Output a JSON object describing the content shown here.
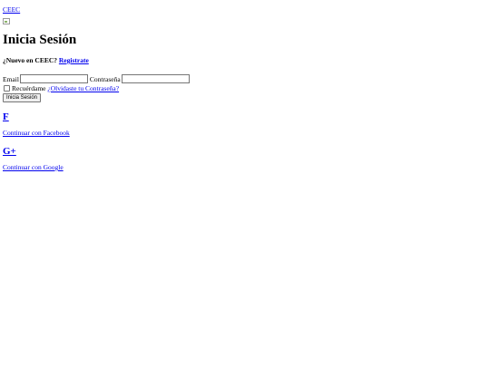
{
  "header": {
    "brand_link": "CEEC"
  },
  "login": {
    "title": "Inicia Sesión",
    "new_prompt": "¿Nuevo en CEEC?",
    "register_link": "Registrate",
    "email_label": "Email",
    "email_value": "",
    "password_label": "Contraseña",
    "password_value": "",
    "remember_label": "Recuérdame",
    "remember_checked": false,
    "forgot_link": "¿Olvidaste tu Contraseña?",
    "submit_label": "Inicia Sesión"
  },
  "social": {
    "facebook_glyph": "F",
    "facebook_text": "Continuar con Facebook",
    "google_glyph": "G+",
    "google_text": "Continuar con Google"
  }
}
